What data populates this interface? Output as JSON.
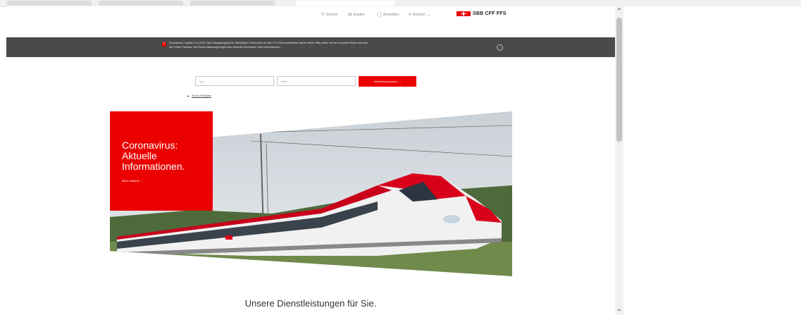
{
  "header": {
    "search_label": "Suchen",
    "buy_label": "Kaufen",
    "login_label": "Anmelden",
    "language_label": "Deutsch",
    "brand": "SBB CFF FFS"
  },
  "banner": {
    "line1": "Coronavirus / Update 24.4.2020: Das Fahrplanangebot im Öffentlichen Verkehr wird ab dem 27.4.2020 schrittweise wieder erhöht. Bitte prüfen Sie kurz vor jeder Reise nochmals",
    "line2": "den Online-Fahrplan. Die Social-Distancing-Regeln sind weiterhin einzuhalten. Mehr Informationen"
  },
  "search": {
    "from_placeholder": "Von",
    "to_placeholder": "Nach",
    "button_label": "Verbindung suchen",
    "touch_link": "Touch-Fahrplan"
  },
  "hero": {
    "title": "Coronavirus: Aktuelle Informationen.",
    "link": "Mehr erfahren"
  },
  "services_title": "Unsere Dienstleistungen für Sie.",
  "colors": {
    "brand_red": "#eb0000",
    "banner_bg": "#4a4a4a"
  },
  "icons": {
    "search": "search-icon",
    "buy": "cart-icon",
    "login": "user-icon",
    "language": "globe-icon",
    "touch": "cloud-icon"
  }
}
